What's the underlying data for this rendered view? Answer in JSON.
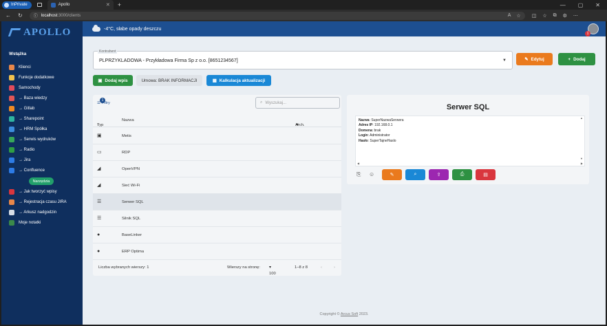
{
  "browser": {
    "inprivate": "InPrivate",
    "tab_title": "Apollo",
    "url_host": "localhost",
    "url_path": ":3000/clients"
  },
  "app": {
    "logo": "APOLLO",
    "weather": "-4°C, słabe opady deszczu",
    "avatar_badge": "1"
  },
  "sidebar": {
    "section": "Wstążka",
    "items": [
      {
        "label": "Klienci",
        "icon": "users-icon",
        "color": "#e8874a"
      },
      {
        "label": "Funkcje dodatkowe",
        "icon": "tools-icon",
        "color": "#f2c14e"
      },
      {
        "label": "Samochody",
        "icon": "car-icon",
        "color": "#e04b5b"
      },
      {
        "label": "→ Baza wiedzy",
        "icon": "book-icon",
        "color": "#e05656"
      },
      {
        "label": "→ Gitlab",
        "icon": "gitlab-icon",
        "color": "#f08a24"
      },
      {
        "label": "→ Sharepoint",
        "icon": "sharepoint-icon",
        "color": "#2fb5a0"
      },
      {
        "label": "→ HRM Spółka",
        "icon": "hrm-icon",
        "color": "#3c8dde"
      },
      {
        "label": "→ Serwis wydruków",
        "icon": "printer-icon",
        "color": "#37a85a"
      },
      {
        "label": "→ Radio",
        "icon": "radio-icon",
        "color": "#2f9e44"
      },
      {
        "label": "→ Jira",
        "icon": "jira-icon",
        "color": "#2d7be5"
      },
      {
        "label": "→ Confluence",
        "icon": "confluence-icon",
        "color": "#2d7be5"
      }
    ],
    "tools_label": "Narzędzia",
    "items2": [
      {
        "label": "→ Jak tworzyć wpisy",
        "icon": "help-icon",
        "color": "#d9363e"
      },
      {
        "label": "→ Rejestracja czasu JIRA",
        "icon": "clock-icon",
        "color": "#e8874a"
      },
      {
        "label": "→ Arkusz nadgodzin",
        "icon": "hourglass-icon",
        "color": "#d8dee6"
      },
      {
        "label": "Moje notatki",
        "icon": "notes-icon",
        "color": "#3b8a4a"
      }
    ]
  },
  "contractor": {
    "label": "Kontrahent",
    "value": "PLPRZYKLADOWA - Przykładowa Firma Sp z o.o. [8651234567]"
  },
  "actions": {
    "edit": "Edytuj",
    "add": "Dodaj",
    "add_entry": "Dodaj wpis",
    "agreement": "Umowa: BRAK INFORMACJI",
    "calc": "Kalkulacja aktualizacji",
    "colors": {
      "orange": "#ea7a1d",
      "green": "#2e9142",
      "blue": "#1a88d6"
    }
  },
  "list": {
    "filters": "Filtry",
    "filters_count": "1",
    "search_placeholder": "Wyszukaj...",
    "col_type": "Typ",
    "col_name": "Nazwa",
    "col_arch": "Arch.",
    "rows": [
      {
        "icon": "terminal-icon",
        "name": "Metis"
      },
      {
        "icon": "monitor-icon",
        "name": "RDP"
      },
      {
        "icon": "rss-icon",
        "name": "OpenVPN"
      },
      {
        "icon": "rss-icon",
        "name": "Sieć Wi-Fi"
      },
      {
        "icon": "list-icon",
        "name": "Serwer SQL"
      },
      {
        "icon": "list-icon",
        "name": "Silnik SQL"
      },
      {
        "icon": "lightbulb-icon",
        "name": "BaseLinker"
      },
      {
        "icon": "lightbulb-icon",
        "name": "ERP Optima"
      }
    ],
    "selected_count": "Liczba wybranych wierszy: 1",
    "rows_per_page_label": "Wierszy na stronę:",
    "rows_per_page": "100",
    "range": "1–8 z 8"
  },
  "detail": {
    "title": "Serwer SQL",
    "fields": [
      {
        "k": "Nazwa",
        "v": "SuperNazwaSerwera"
      },
      {
        "k": "Adres IP",
        "v": "192.168.0.1"
      },
      {
        "k": "Domena",
        "v": "brak"
      },
      {
        "k": "Login",
        "v": "Administrator"
      },
      {
        "k": "Hasło",
        "v": "SuperTajneHaslo"
      }
    ],
    "button_colors": [
      "#ea7a1d",
      "#1a88d6",
      "#9c27b0",
      "#2e9142",
      "#d9363e"
    ]
  },
  "footer": {
    "prefix": "Copyright ©",
    "link": "Arcus Soft",
    "suffix": "2023."
  }
}
